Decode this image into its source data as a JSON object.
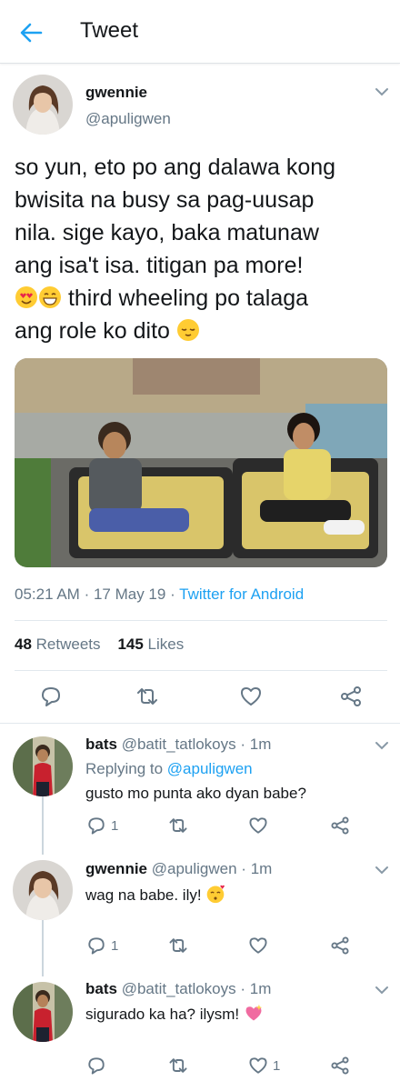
{
  "appbar": {
    "title": "Tweet"
  },
  "tweet": {
    "name": "gwennie",
    "handle": "@apuligwen",
    "lines": [
      "so yun, eto po ang dalawa kong",
      "bwisita na busy sa pag-uusap",
      "nila. sige kayo, baka matunaw",
      "ang isa't isa. titigan pa more!",
      "third wheeling po talaga",
      "ang role ko dito"
    ],
    "emojis": [
      "heart-eyes-emoji",
      "grinning-emoji",
      "relieved-emoji"
    ],
    "time": "05:21 AM",
    "date": "17 May 19",
    "source": "Twitter for Android",
    "retweets_count": "48",
    "retweets_label": "Retweets",
    "likes_count": "145",
    "likes_label": "Likes"
  },
  "replies": [
    {
      "name": "bats",
      "handle": "@batit_tatlokoys",
      "time": "1m",
      "replying_label": "Replying to",
      "replying_to": "@apuligwen",
      "text": "gusto mo punta ako dyan babe?",
      "reply_count": "1",
      "like_count": ""
    },
    {
      "name": "gwennie",
      "handle": "@apuligwen",
      "time": "1m",
      "text": "wag na babe. ily!",
      "emoji": "kissing-emoji",
      "reply_count": "1",
      "like_count": ""
    },
    {
      "name": "bats",
      "handle": "@batit_tatlokoys",
      "time": "1m",
      "text": "sigurado ka ha? ilysm!",
      "emoji": "sparkling-heart-emoji",
      "reply_count": "",
      "like_count": "1"
    }
  ],
  "colors": {
    "accent": "#1da1f2",
    "secondary_text": "#657786",
    "divider": "#e1e8ed"
  }
}
